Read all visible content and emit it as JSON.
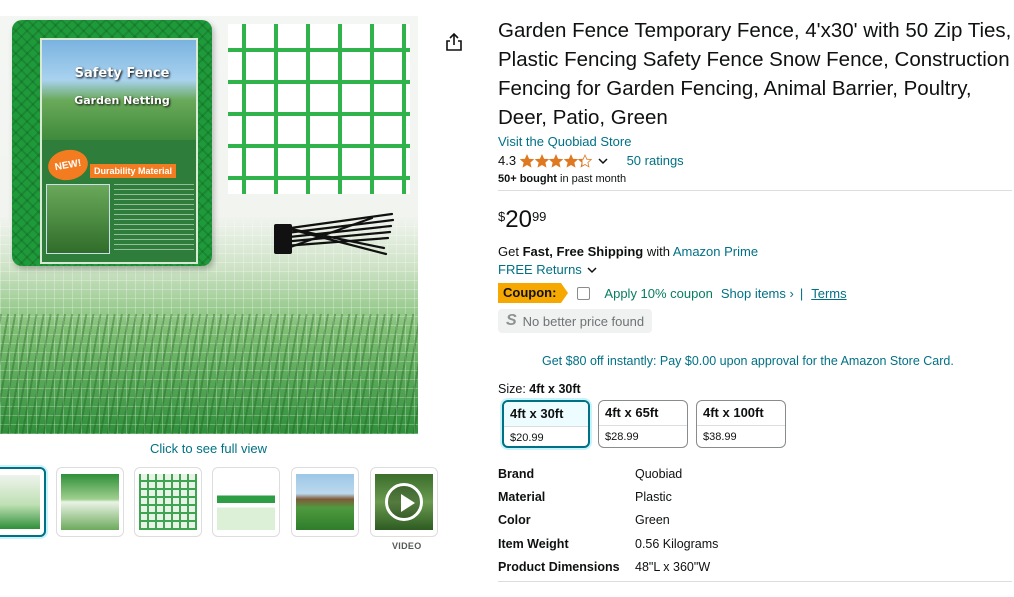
{
  "gallery": {
    "hero": {
      "package_title": "Safety Fence",
      "package_subtitle": "Garden Netting",
      "package_badge": "NEW!",
      "package_banner": "Durability Material"
    },
    "click_full_view": "Click to see full view",
    "video_label": "VIDEO",
    "thumbnails": [
      {
        "name": "main",
        "selected": true
      },
      {
        "name": "installation",
        "selected": false
      },
      {
        "name": "fence-closeup",
        "selected": false
      },
      {
        "name": "size-chart",
        "selected": false
      },
      {
        "name": "field-use",
        "selected": false
      },
      {
        "name": "video",
        "selected": false
      }
    ],
    "accent_color": "#1f9a3a"
  },
  "product": {
    "title": "Garden Fence Temporary Fence, 4'x30' with 50 Zip Ties, Plastic Fencing Safety Fence Snow Fence, Construction Fencing for Garden Fencing, Animal Barrier, Poultry, Deer, Patio, Green",
    "store_link": "Visit the Quobiad Store",
    "rating": "4.3",
    "rating_stars": 4.3,
    "ratings_count": "50 ratings",
    "bought_bold": "50+ bought",
    "bought_rest": " in past month"
  },
  "price": {
    "symbol": "$",
    "whole": "20",
    "fraction": "99"
  },
  "shipping": {
    "prefix": "Get ",
    "bold": "Fast, Free Shipping",
    "mid": " with ",
    "link": "Amazon Prime",
    "returns": "FREE Returns"
  },
  "coupon": {
    "badge": "Coupon:",
    "label": "Apply 10% coupon",
    "shop_items": "Shop items ›",
    "separator": "|",
    "terms": "Terms",
    "checked": false
  },
  "no_better_price": {
    "icon_letter": "S",
    "text": "No better price found"
  },
  "card_offer": "Get $80 off instantly: Pay $0.00 upon approval for the Amazon Store Card.",
  "size": {
    "label": "Size:",
    "selected": "4ft x 30ft",
    "options": [
      {
        "label": "4ft x 30ft",
        "price": "$20.99",
        "selected": true
      },
      {
        "label": "4ft x 65ft",
        "price": "$28.99",
        "selected": false
      },
      {
        "label": "4ft x 100ft",
        "price": "$38.99",
        "selected": false
      }
    ]
  },
  "specs": [
    {
      "key": "Brand",
      "value": "Quobiad"
    },
    {
      "key": "Material",
      "value": "Plastic"
    },
    {
      "key": "Color",
      "value": "Green"
    },
    {
      "key": "Item Weight",
      "value": "0.56 Kilograms"
    },
    {
      "key": "Product Dimensions",
      "value": "48\"L x 360\"W"
    }
  ],
  "colors": {
    "link": "#007185",
    "star": "#de7921",
    "coupon_badge": "#f7a800",
    "coupon_text": "#067d62"
  },
  "icons": {
    "share": "share-icon",
    "star": "star-icon",
    "chevron": "chevron-down-icon",
    "play": "play-icon"
  }
}
